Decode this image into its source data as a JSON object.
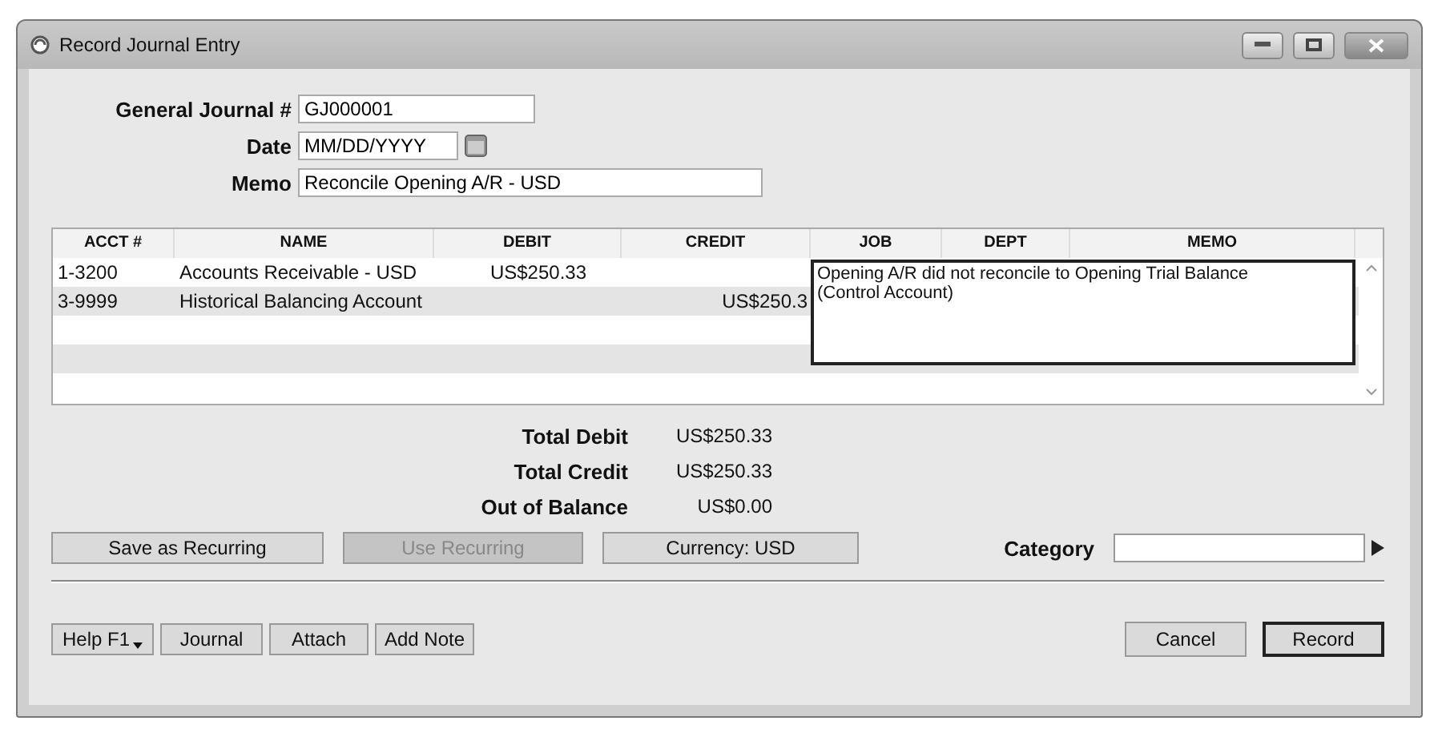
{
  "window": {
    "title": "Record Journal Entry"
  },
  "header": {
    "journal_label": "General Journal #",
    "journal_value": "GJ000001",
    "date_label": "Date",
    "date_value": "MM/DD/YYYY",
    "memo_label": "Memo",
    "memo_value": "Reconcile Opening A/R - USD"
  },
  "table": {
    "columns": [
      "ACCT #",
      "NAME",
      "DEBIT",
      "CREDIT",
      "JOB",
      "DEPT",
      "MEMO"
    ],
    "rows": [
      {
        "acct": "1-3200",
        "name": "Accounts Receivable - USD",
        "debit": "US$250.33",
        "credit": ""
      },
      {
        "acct": "3-9999",
        "name": "Historical Balancing Account",
        "debit": "",
        "credit": "US$250.3"
      }
    ],
    "memo_editor": "Opening A/R did not reconcile to Opening Trial Balance (Control Account)"
  },
  "totals": [
    {
      "label": "Total Debit",
      "value": "US$250.33"
    },
    {
      "label": "Total Credit",
      "value": "US$250.33"
    },
    {
      "label": "Out of Balance",
      "value": "US$0.00"
    }
  ],
  "actions": [
    {
      "label": "Save as Recurring",
      "disabled": false
    },
    {
      "label": "Use Recurring",
      "disabled": true
    },
    {
      "label": "Currency: USD",
      "disabled": false
    }
  ],
  "category": {
    "label": "Category"
  },
  "footer_left": [
    {
      "label": "Help F1",
      "kind": "dropdown"
    },
    {
      "label": "Journal",
      "kind": "plain"
    },
    {
      "label": "Attach",
      "kind": "plain"
    },
    {
      "label": "Add Note",
      "kind": "plain"
    }
  ],
  "footer_right": [
    {
      "label": "Cancel",
      "default": false
    },
    {
      "label": "Record",
      "default": true
    }
  ]
}
